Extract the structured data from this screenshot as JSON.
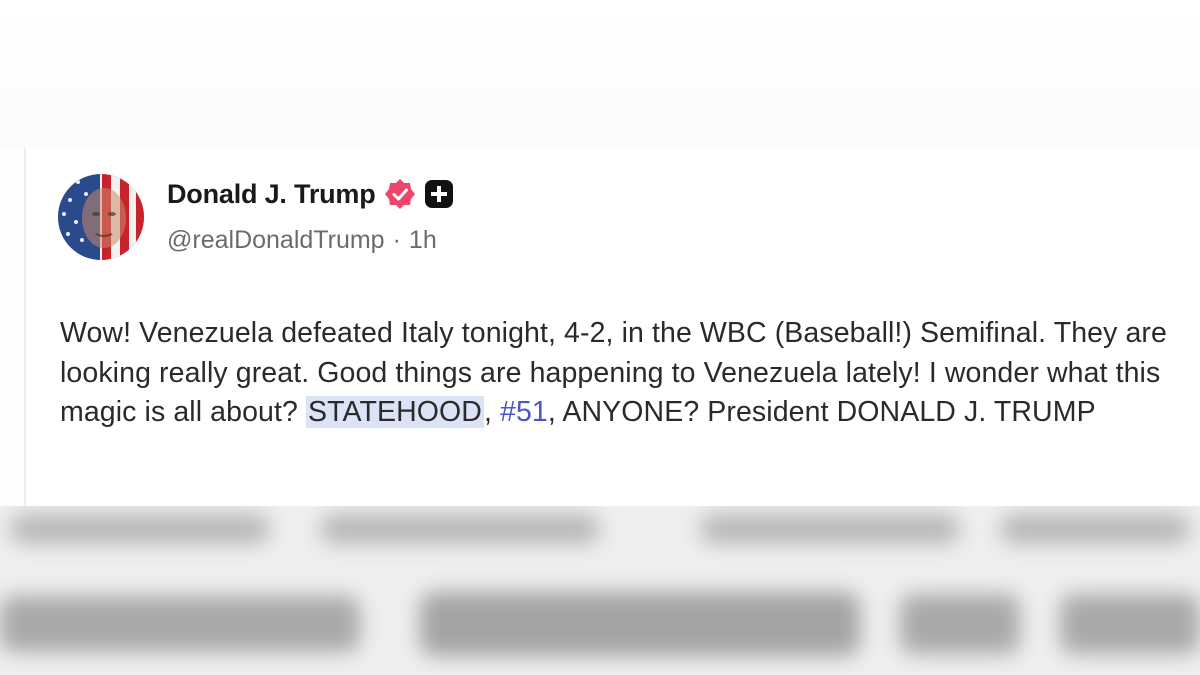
{
  "post": {
    "display_name": "Donald J. Trump",
    "handle": "@realDonaldTrump",
    "separator": "·",
    "timestamp": "1h",
    "text_segments": {
      "part1": "Wow! Venezuela defeated Italy tonight, 4-2, in the WBC (Baseball!) Semifinal. They are looking really great. Good things are happening to Venezuela lately! I wonder what this magic is all about? ",
      "highlight": "STATEHOOD",
      "part2": ", ",
      "hashtag": "#51",
      "part3": ", ANYONE? President DONALD J. TRUMP"
    }
  },
  "icons": {
    "verified": "verified-badge-icon",
    "plus": "plus-badge-icon",
    "avatar": "avatar-flag-portrait"
  },
  "colors": {
    "verified_pink": "#f0456a",
    "hashtag_blue": "#4a55c9",
    "highlight_bg": "#dde3f7",
    "text": "#2a2a2a",
    "meta_gray": "#6b6b6b"
  }
}
